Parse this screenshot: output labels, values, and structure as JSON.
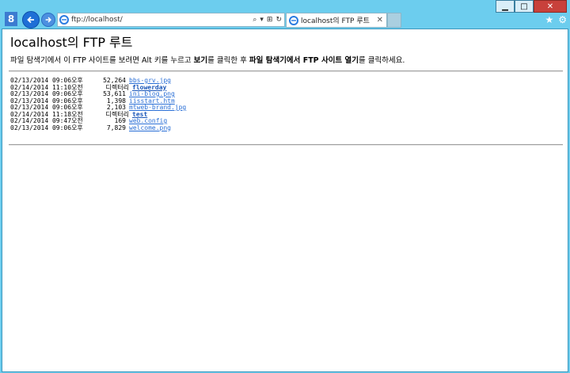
{
  "window": {
    "min_label": "▁",
    "max_label": "□",
    "close_label": "✕"
  },
  "nav": {
    "google_label": "8"
  },
  "address": {
    "url": "ftp://localhost/",
    "search_glyph": "⌕",
    "dropdown_glyph": "▾",
    "compat_glyph": "⊞",
    "refresh_glyph": "↻"
  },
  "tab": {
    "title": "localhost의 FTP 루트",
    "close": "✕"
  },
  "toolbar": {
    "favorites_glyph": "★",
    "tools_glyph": "⚙"
  },
  "page": {
    "heading": "localhost의 FTP 루트",
    "intro_1": "파일 탐색기에서 이 FTP 사이트를 보려면 Alt 키를 누르고 ",
    "intro_b1": "보기",
    "intro_2": "를 클릭한 후 ",
    "intro_b2": "파일 탐색기에서 FTP 사이트 열기",
    "intro_3": "를 클릭하세요."
  },
  "listing": [
    {
      "date": "02/13/2014 09:06오후",
      "size": "52,264",
      "dir": "",
      "name": "bbs-grv.jpg"
    },
    {
      "date": "02/14/2014 11:10오전",
      "size": "",
      "dir": "디렉터리",
      "name": "flowerday"
    },
    {
      "date": "02/13/2014 09:06오후",
      "size": "53,611",
      "dir": "",
      "name": "ini-blog.png"
    },
    {
      "date": "02/13/2014 09:06오후",
      "size": "1,398",
      "dir": "",
      "name": "iisstart.htm"
    },
    {
      "date": "02/13/2014 09:06오후",
      "size": "2,103",
      "dir": "",
      "name": "mtweb-brand.jpg"
    },
    {
      "date": "02/14/2014 11:18오전",
      "size": "",
      "dir": "디렉터리",
      "name": "test"
    },
    {
      "date": "02/14/2014 09:47오전",
      "size": "169",
      "dir": "",
      "name": "web.config"
    },
    {
      "date": "02/13/2014 09:06오후",
      "size": "7,829",
      "dir": "",
      "name": "welcome.png"
    }
  ]
}
